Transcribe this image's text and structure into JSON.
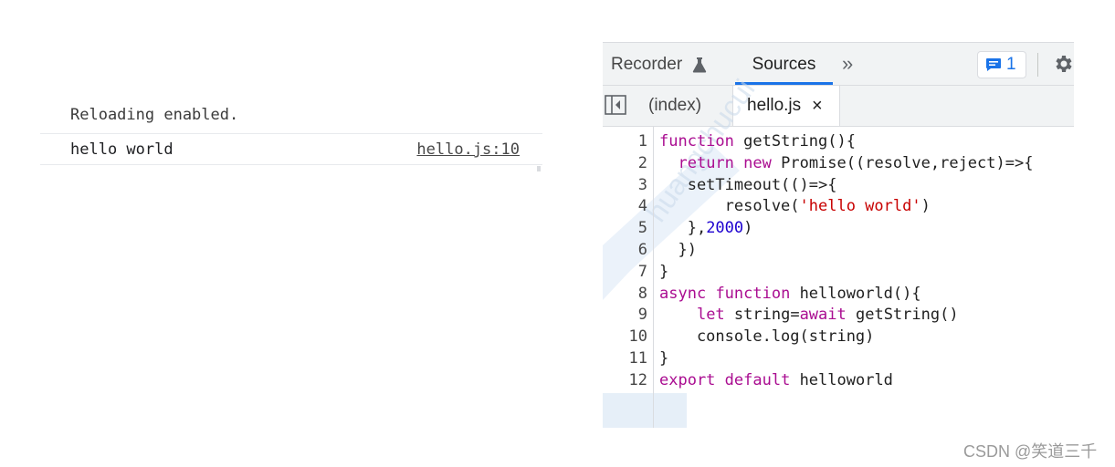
{
  "console": {
    "clipped_line": "Reloading enabled.",
    "message": "hello world",
    "source_link": "hello.js:10"
  },
  "devtools": {
    "tabs": [
      {
        "label": "Recorder",
        "icon": "flask-icon"
      },
      {
        "label": "Sources",
        "active": true
      },
      {
        "label": "»",
        "icon": "more-tabs-icon"
      }
    ],
    "issues_count": "1",
    "files": [
      {
        "label": "(index)"
      },
      {
        "label": "hello.js",
        "active": true,
        "close": "×"
      }
    ],
    "code_lines": [
      {
        "n": "1",
        "text": "function getString(){"
      },
      {
        "n": "2",
        "text": "  return new Promise((resolve,reject)=>{"
      },
      {
        "n": "3",
        "text": "   setTimeout(()=>{"
      },
      {
        "n": "4",
        "text": "       resolve('hello world')"
      },
      {
        "n": "5",
        "text": "   },2000)"
      },
      {
        "n": "6",
        "text": "  })"
      },
      {
        "n": "7",
        "text": "}"
      },
      {
        "n": "8",
        "text": "async function helloworld(){"
      },
      {
        "n": "9",
        "text": "    let string=await getString()"
      },
      {
        "n": "10",
        "text": "    console.log(string)"
      },
      {
        "n": "11",
        "text": "}"
      },
      {
        "n": "12",
        "text": "export default helloworld"
      }
    ],
    "watermark": "huangchucui"
  },
  "credit": "CSDN @笑道三千",
  "colors": {
    "accent": "#1a73e8",
    "keyword": "#aa0d91",
    "string": "#c80000",
    "number": "#1c00cf"
  }
}
